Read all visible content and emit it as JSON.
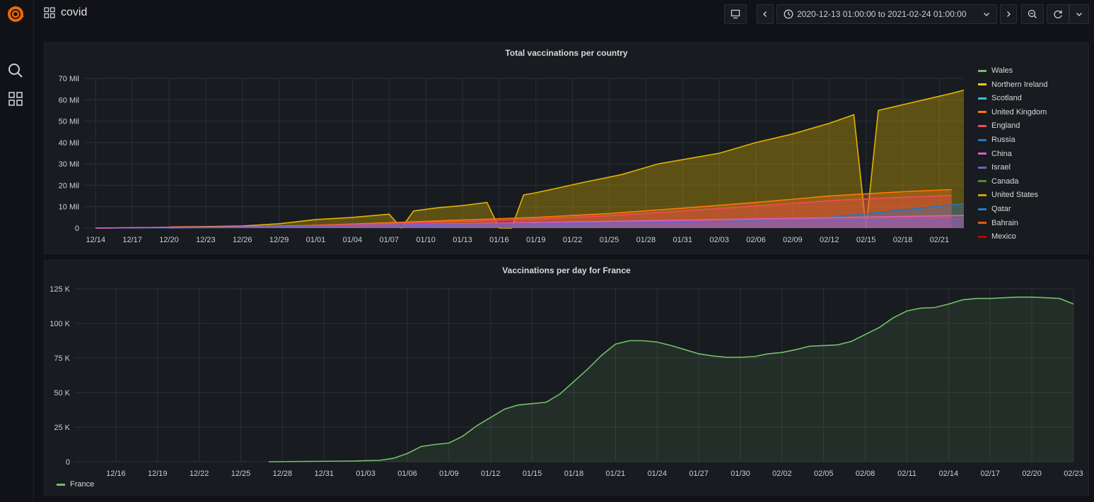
{
  "dashboard": {
    "title": "covid"
  },
  "topbar": {
    "time_range": "2020-12-13 01:00:00 to 2021-02-24 01:00:00"
  },
  "icons": {
    "logo": "grafana-logo-icon",
    "search": "search-icon",
    "dashboards": "dashboards-grid-icon",
    "tv": "tv-mode-icon",
    "prev": "chevron-left-icon",
    "clock": "clock-icon",
    "chevron": "chevron-down-icon",
    "next": "chevron-right-icon",
    "zoom": "zoom-out-icon",
    "refresh": "refresh-icon"
  },
  "chart_data": [
    {
      "type": "area",
      "title": "Total vaccinations per country",
      "y_ticks": [
        "0",
        "10 Mil",
        "20 Mil",
        "30 Mil",
        "40 Mil",
        "50 Mil",
        "60 Mil",
        "70 Mil"
      ],
      "x_ticks": [
        "12/14",
        "12/17",
        "12/20",
        "12/23",
        "12/26",
        "12/29",
        "01/01",
        "01/04",
        "01/07",
        "01/10",
        "01/13",
        "01/16",
        "01/19",
        "01/22",
        "01/25",
        "01/28",
        "01/31",
        "02/03",
        "02/06",
        "02/09",
        "02/12",
        "02/15",
        "02/18",
        "02/21",
        "02/2"
      ],
      "ylim": [
        0,
        70000000
      ],
      "grid": true,
      "legend_position": "right",
      "legend": [
        {
          "name": "Wales",
          "color": "#73bf69"
        },
        {
          "name": "Northern Ireland",
          "color": "#f2cc0c"
        },
        {
          "name": "Scotland",
          "color": "#39c1e3"
        },
        {
          "name": "United Kingdom",
          "color": "#ff780a"
        },
        {
          "name": "England",
          "color": "#f2495c"
        },
        {
          "name": "Russia",
          "color": "#1f78c1"
        },
        {
          "name": "China",
          "color": "#de5cc0"
        },
        {
          "name": "Israel",
          "color": "#7a5ebd"
        },
        {
          "name": "Canada",
          "color": "#508642"
        },
        {
          "name": "United States",
          "color": "#cca300"
        },
        {
          "name": "Qatar",
          "color": "#2f7bbf"
        },
        {
          "name": "Bahrain",
          "color": "#e0600b"
        },
        {
          "name": "Mexico",
          "color": "#c00000"
        }
      ],
      "series": [
        {
          "name": "United States",
          "color": "#e0b400",
          "x": [
            "12/20",
            "12/23",
            "12/26",
            "12/29",
            "01/01",
            "01/04",
            "01/07",
            "01/08",
            "01/09",
            "01/11",
            "01/13",
            "01/15",
            "01/16",
            "01/17",
            "01/18",
            "01/19",
            "01/21",
            "01/23",
            "01/26",
            "01/29",
            "02/01",
            "02/03",
            "02/06",
            "02/09",
            "02/12",
            "02/14",
            "02/15",
            "02/16",
            "02/19",
            "02/22",
            "02/24"
          ],
          "values": [
            500000,
            700000,
            1000000,
            2000000,
            4000000,
            5000000,
            6500000,
            0,
            8000000,
            9500000,
            10500000,
            12000000,
            0,
            0,
            15500000,
            16500000,
            19000000,
            21500000,
            25000000,
            30000000,
            33000000,
            35000000,
            40000000,
            44000000,
            49000000,
            53000000,
            0,
            55000000,
            59000000,
            63000000,
            66000000
          ]
        },
        {
          "name": "United Kingdom",
          "color": "#ff780a",
          "x": [
            "12/14",
            "12/20",
            "12/26",
            "01/01",
            "01/07",
            "01/13",
            "01/19",
            "01/25",
            "01/31",
            "02/06",
            "02/12",
            "02/18",
            "02/22"
          ],
          "values": [
            0,
            300000,
            600000,
            1300000,
            2500000,
            3800000,
            5000000,
            6800000,
            9300000,
            12000000,
            15000000,
            17000000,
            18000000
          ]
        },
        {
          "name": "England",
          "color": "#f2495c",
          "x": [
            "12/14",
            "12/20",
            "12/26",
            "01/01",
            "01/07",
            "01/13",
            "01/19",
            "01/25",
            "01/31",
            "02/06",
            "02/12",
            "02/18",
            "02/22"
          ],
          "values": [
            0,
            250000,
            500000,
            1100000,
            2100000,
            3200000,
            4200000,
            5800000,
            8000000,
            10300000,
            12800000,
            14400000,
            15300000
          ]
        },
        {
          "name": "Russia",
          "color": "#1f78c1",
          "x": [
            "12/14",
            "01/07",
            "01/31",
            "02/12",
            "02/24"
          ],
          "values": [
            0,
            500000,
            2500000,
            5000000,
            12000000
          ]
        },
        {
          "name": "China",
          "color": "#de5cc0",
          "x": [
            "12/14",
            "01/01",
            "01/13",
            "02/03",
            "02/24"
          ],
          "values": [
            0,
            1000000,
            2000000,
            4000000,
            6000000
          ]
        },
        {
          "name": "Israel",
          "color": "#7a5ebd",
          "x": [
            "12/20",
            "01/07",
            "01/31",
            "02/24"
          ],
          "values": [
            0,
            1500000,
            2800000,
            4000000
          ]
        }
      ]
    },
    {
      "type": "area",
      "title": "Vaccinations per day for France",
      "y_ticks": [
        "0",
        "25 K",
        "50 K",
        "75 K",
        "100 K",
        "125 K"
      ],
      "x_ticks": [
        "12/16",
        "12/19",
        "12/22",
        "12/25",
        "12/28",
        "12/31",
        "01/03",
        "01/06",
        "01/09",
        "01/12",
        "01/15",
        "01/18",
        "01/21",
        "01/24",
        "01/27",
        "01/30",
        "02/02",
        "02/05",
        "02/08",
        "02/11",
        "02/14",
        "02/17",
        "02/20",
        "02/23"
      ],
      "ylim": [
        0,
        125000
      ],
      "grid": true,
      "legend_position": "bottom-left",
      "series": [
        {
          "name": "France",
          "color": "#73bf69",
          "x": [
            "12/27",
            "12/30",
            "01/02",
            "01/04",
            "01/05",
            "01/06",
            "01/07",
            "01/08",
            "01/09",
            "01/10",
            "01/11",
            "01/12",
            "01/13",
            "01/14",
            "01/15",
            "01/16",
            "01/17",
            "01/18",
            "01/19",
            "01/20",
            "01/21",
            "01/22",
            "01/23",
            "01/24",
            "01/25",
            "01/26",
            "01/27",
            "01/28",
            "01/29",
            "01/30",
            "01/31",
            "02/01",
            "02/02",
            "02/03",
            "02/04",
            "02/05",
            "02/06",
            "02/07",
            "02/08",
            "02/09",
            "02/10",
            "02/11",
            "02/12",
            "02/13",
            "02/14",
            "02/15",
            "02/16",
            "02/17",
            "02/18",
            "02/19",
            "02/20",
            "02/21",
            "02/22",
            "02/23"
          ],
          "values": [
            0,
            300,
            500,
            1000,
            2500,
            6000,
            11000,
            12500,
            13500,
            18500,
            26000,
            32000,
            38000,
            41000,
            42000,
            43000,
            49000,
            58000,
            67000,
            77000,
            85000,
            87500,
            87500,
            86500,
            84000,
            81000,
            78000,
            76500,
            75500,
            75500,
            76000,
            78000,
            79000,
            81000,
            83500,
            84000,
            84500,
            87000,
            92000,
            97000,
            104000,
            109000,
            111000,
            111500,
            114000,
            117000,
            118000,
            118000,
            118500,
            119000,
            119000,
            118500,
            118000,
            114000
          ]
        }
      ]
    }
  ]
}
